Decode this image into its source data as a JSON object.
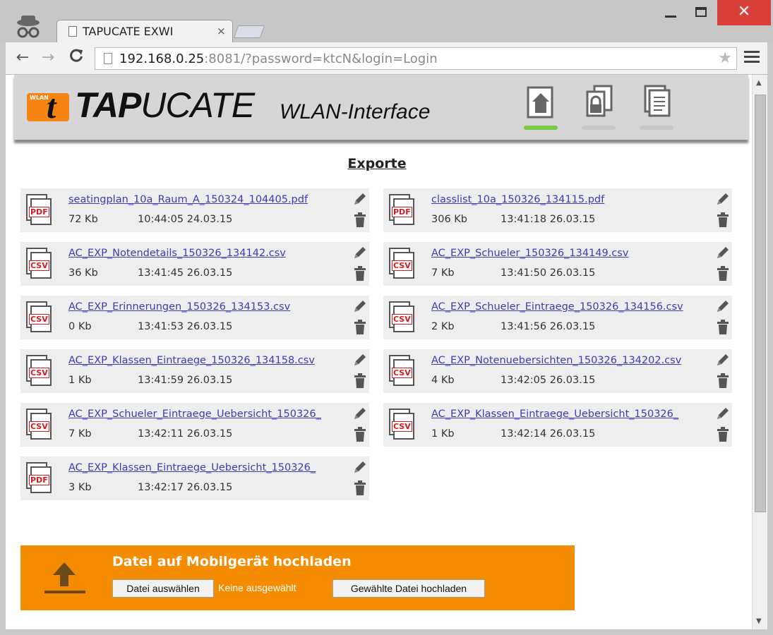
{
  "browser": {
    "tab_title": "TAPUCATE EXWI",
    "tab_close": "×",
    "url_host": "192.168.0.25",
    "url_rest": ":8081/?password=ktcN&login=Login",
    "back": "←",
    "forward": "→",
    "reload": "C",
    "star": "★",
    "close_glyph": "✕"
  },
  "header": {
    "logo_badge": "WLAN",
    "logo_t": "t",
    "logo_bold": "TAP",
    "logo_light": "UCATE",
    "subtitle": "WLAN-Interface",
    "nav_icons": [
      "home-icon",
      "lock-icon",
      "documents-icon"
    ],
    "active_indicator_color": "#7ac943"
  },
  "exports": {
    "title": "Exporte",
    "files": [
      {
        "type": "PDF",
        "name": "seatingplan_10a_Raum_A_150324_104405.pdf",
        "size": "72 Kb",
        "time": "10:44:05 24.03.15"
      },
      {
        "type": "PDF",
        "name": "classlist_10a_150326_134115.pdf",
        "size": "306 Kb",
        "time": "13:41:18 26.03.15"
      },
      {
        "type": "CSV",
        "name": "AC_EXP_Notendetails_150326_134142.csv",
        "size": "36 Kb",
        "time": "13:41:45 26.03.15"
      },
      {
        "type": "CSV",
        "name": "AC_EXP_Schueler_150326_134149.csv",
        "size": "7 Kb",
        "time": "13:41:50 26.03.15"
      },
      {
        "type": "CSV",
        "name": "AC_EXP_Erinnerungen_150326_134153.csv",
        "size": "0 Kb",
        "time": "13:41:53 26.03.15"
      },
      {
        "type": "CSV",
        "name": "AC_EXP_Schueler_Eintraege_150326_134156.csv",
        "size": "2 Kb",
        "time": "13:41:56 26.03.15"
      },
      {
        "type": "CSV",
        "name": "AC_EXP_Klassen_Eintraege_150326_134158.csv",
        "size": "1 Kb",
        "time": "13:41:59 26.03.15"
      },
      {
        "type": "CSV",
        "name": "AC_EXP_Notenuebersichten_150326_134202.csv",
        "size": "4 Kb",
        "time": "13:42:05 26.03.15"
      },
      {
        "type": "CSV",
        "name": "AC_EXP_Schueler_Eintraege_Uebersicht_150326_",
        "size": "7 Kb",
        "time": "13:42:11 26.03.15"
      },
      {
        "type": "CSV",
        "name": "AC_EXP_Klassen_Eintraege_Uebersicht_150326_",
        "size": "1 Kb",
        "time": "13:42:14 26.03.15"
      },
      {
        "type": "PDF",
        "name": "AC_EXP_Klassen_Eintraege_Uebersicht_150326_",
        "size": "3 Kb",
        "time": "13:42:17 26.03.15"
      }
    ]
  },
  "upload": {
    "title": "Datei auf Mobilgerät hochladen",
    "choose_label": "Datei auswählen",
    "no_file_label": "Keine ausgewählt",
    "upload_label": "Gewählte Datei hochladen",
    "color": "#f58c00"
  }
}
